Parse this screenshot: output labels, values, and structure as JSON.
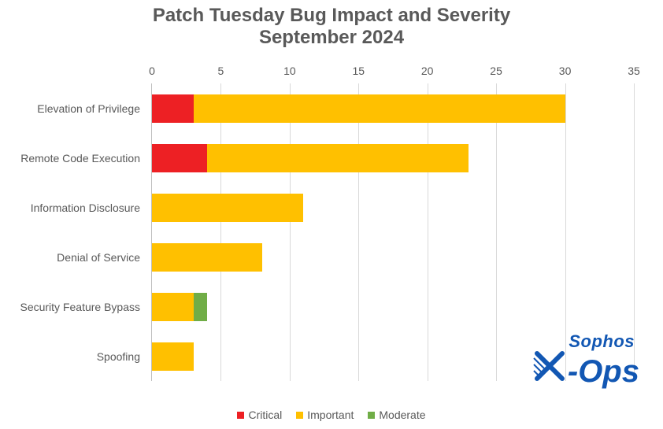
{
  "chart_data": {
    "type": "bar",
    "orientation": "horizontal",
    "stacked": true,
    "title": "Patch Tuesday Bug Impact and Severity",
    "subtitle": "September 2024",
    "xlabel": "",
    "ylabel": "",
    "xlim": [
      0,
      35
    ],
    "x_ticks": [
      0,
      5,
      10,
      15,
      20,
      25,
      30,
      35
    ],
    "categories": [
      "Elevation of Privilege",
      "Remote Code Execution",
      "Information Disclosure",
      "Denial of Service",
      "Security Feature Bypass",
      "Spoofing"
    ],
    "series": [
      {
        "name": "Critical",
        "color": "#ed2024",
        "values": [
          3,
          4,
          0,
          0,
          0,
          0
        ]
      },
      {
        "name": "Important",
        "color": "#ffc000",
        "values": [
          27,
          19,
          11,
          8,
          3,
          3
        ]
      },
      {
        "name": "Moderate",
        "color": "#70ad47",
        "values": [
          0,
          0,
          0,
          0,
          1,
          0
        ]
      }
    ],
    "legend_position": "bottom"
  },
  "brand": {
    "line1": "Sophos",
    "line2_left": "X",
    "line2_right": "-Ops"
  }
}
